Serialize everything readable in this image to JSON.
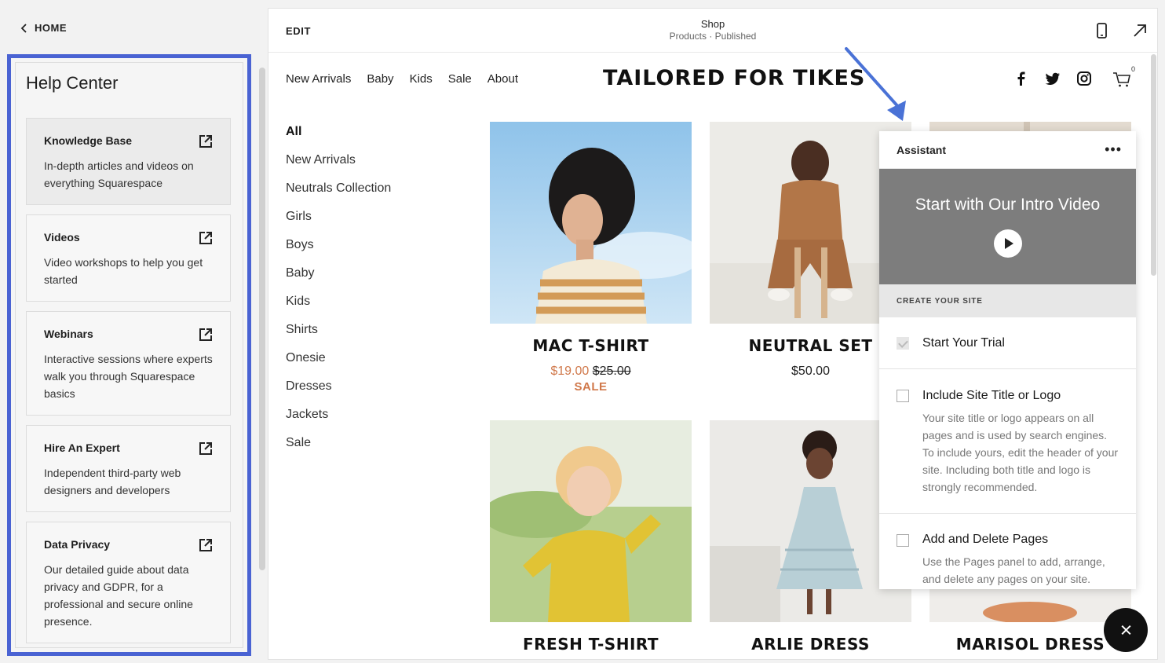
{
  "nav": {
    "home_label": "HOME"
  },
  "help_center": {
    "title": "Help Center",
    "cards": [
      {
        "title": "Knowledge Base",
        "desc": "In-depth articles and videos on everything Squarespace"
      },
      {
        "title": "Videos",
        "desc": "Video workshops to help you get started"
      },
      {
        "title": "Webinars",
        "desc": "Interactive sessions where experts walk you through Squarespace basics"
      },
      {
        "title": "Hire An Expert",
        "desc": "Independent third-party web designers and developers"
      },
      {
        "title": "Data Privacy",
        "desc": "Our detailed guide about data privacy and GDPR, for a professional and secure online presence."
      }
    ]
  },
  "editor": {
    "edit_label": "EDIT",
    "page_name": "Shop",
    "page_status": "Products · Published"
  },
  "site": {
    "logo": "TAILORED FOR TIKES",
    "nav": [
      "New Arrivals",
      "Baby",
      "Kids",
      "Sale",
      "About"
    ],
    "cart_count": "0",
    "categories": [
      "All",
      "New Arrivals",
      "Neutrals Collection",
      "Girls",
      "Boys",
      "Baby",
      "Kids",
      "Shirts",
      "Onesie",
      "Dresses",
      "Jackets",
      "Sale"
    ],
    "products": [
      {
        "name": "MAC T-SHIRT",
        "sale_price": "$19.00",
        "orig_price": "$25.00",
        "badge": "SALE"
      },
      {
        "name": "NEUTRAL SET",
        "price": "$50.00"
      },
      {
        "name": "FRESH T-SHIRT"
      },
      {
        "name": "ARLIE DRESS"
      },
      {
        "name": "MARISOL DRESS"
      }
    ]
  },
  "assistant": {
    "title": "Assistant",
    "menu": "•••",
    "video_title": "Start with Our Intro Video",
    "section": "CREATE YOUR SITE",
    "tasks": [
      {
        "title": "Start Your Trial",
        "done": true
      },
      {
        "title": "Include Site Title or Logo",
        "desc": "Your site title or logo appears on all pages and is used by search engines. To include yours, edit the header of your site. Including both title and logo is strongly recommended."
      },
      {
        "title": "Add and Delete Pages",
        "desc": "Use the Pages panel to add, arrange, and delete any pages on your site."
      }
    ]
  },
  "colors": {
    "highlight_border": "#4a63d3",
    "sale": "#d0784a",
    "arrow": "#4a72d6"
  }
}
